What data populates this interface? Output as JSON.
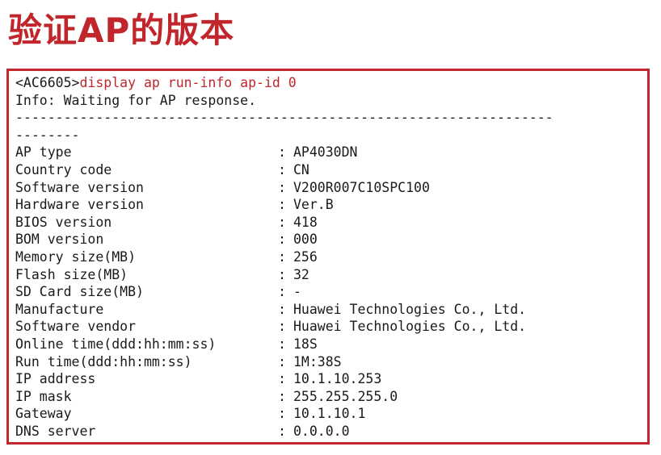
{
  "title": "验证AP的版本",
  "terminal": {
    "prompt": "<AC6605>",
    "command": "display ap run-info ap-id 0",
    "info": "Info: Waiting for AP response.",
    "separator1": "-------------------------------------------------------------------",
    "separator2": "--------",
    "fields": [
      {
        "label": "AP type",
        "value": "AP4030DN"
      },
      {
        "label": "Country code",
        "value": "CN"
      },
      {
        "label": "Software version",
        "value": "V200R007C10SPC100"
      },
      {
        "label": "Hardware version",
        "value": "Ver.B"
      },
      {
        "label": "BIOS version",
        "value": "418"
      },
      {
        "label": "BOM version",
        "value": "000"
      },
      {
        "label": "Memory size(MB)",
        "value": "256"
      },
      {
        "label": "Flash size(MB)",
        "value": "32"
      },
      {
        "label": "SD Card size(MB)",
        "value": "-"
      },
      {
        "label": "Manufacture",
        "value": "Huawei Technologies Co., Ltd."
      },
      {
        "label": "Software vendor",
        "value": "Huawei Technologies Co., Ltd."
      },
      {
        "label": "Online time(ddd:hh:mm:ss)",
        "value": "18S"
      },
      {
        "label": "Run time(ddd:hh:mm:ss)",
        "value": "1M:38S"
      },
      {
        "label": "IP address",
        "value": "10.1.10.253"
      },
      {
        "label": "IP mask",
        "value": "255.255.255.0"
      },
      {
        "label": "Gateway",
        "value": "10.1.10.1"
      },
      {
        "label": "DNS server",
        "value": "0.0.0.0"
      }
    ],
    "colon": ":"
  }
}
